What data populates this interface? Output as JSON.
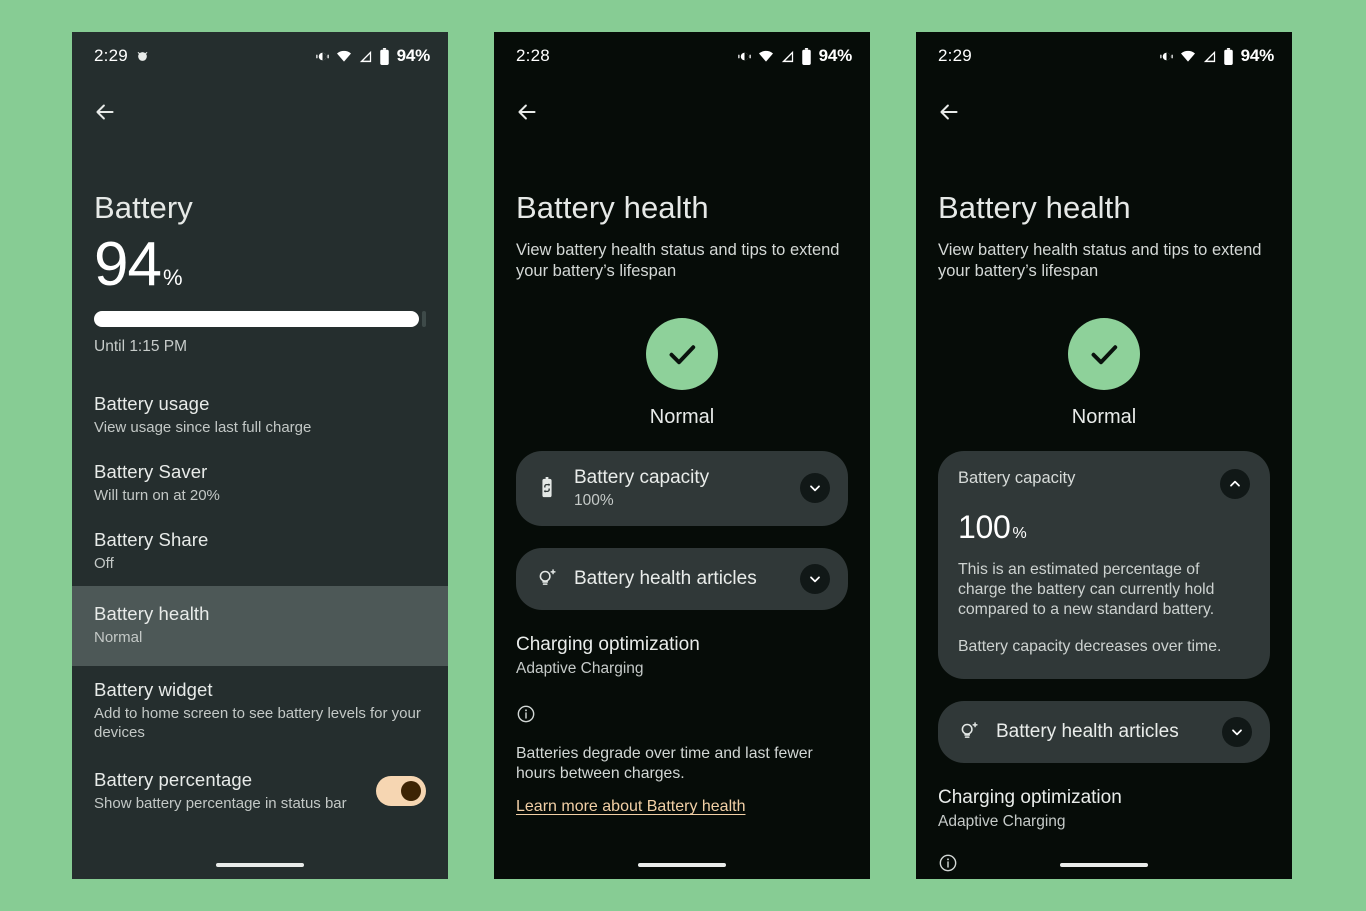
{
  "canvas": {
    "background_color": "#87cc94"
  },
  "phones": [
    {
      "id": "battery-settings",
      "background_color": "#252e2e",
      "status_bar": {
        "time": "2:29",
        "battery_percent": "94%",
        "icons": [
          "alarm-icon",
          "vibrate-icon",
          "wifi-icon",
          "signal-icon",
          "battery-icon"
        ]
      },
      "back_label": "back-arrow",
      "title": "Battery",
      "level": {
        "value": "94",
        "symbol": "%",
        "fill_percent": 94
      },
      "until_text": "Until 1:15 PM",
      "items": [
        {
          "title": "Battery usage",
          "subtitle": "View usage since last full charge",
          "highlighted": false
        },
        {
          "title": "Battery Saver",
          "subtitle": "Will turn on at 20%",
          "highlighted": false
        },
        {
          "title": "Battery Share",
          "subtitle": "Off",
          "highlighted": false
        },
        {
          "title": "Battery health",
          "subtitle": "Normal",
          "highlighted": true
        },
        {
          "title": "Battery widget",
          "subtitle": "Add to home screen to see battery levels for your devices",
          "highlighted": false
        },
        {
          "title": "Battery percentage",
          "subtitle": "Show battery percentage in status bar",
          "highlighted": false,
          "toggle": "on"
        }
      ],
      "highlight_color": "#4d5857",
      "toggle_color": "#f6d6b2"
    },
    {
      "id": "battery-health-collapsed",
      "background_color": "#060c08",
      "status_bar": {
        "time": "2:28",
        "battery_percent": "94%",
        "icons": [
          "vibrate-icon",
          "wifi-icon",
          "signal-icon",
          "battery-icon"
        ]
      },
      "title": "Battery health",
      "subtitle": "View battery health status and tips to extend your battery’s lifespan",
      "status": {
        "label": "Normal",
        "icon": "check-icon",
        "color": "#8ed19a"
      },
      "cards": [
        {
          "icon": "battery-refresh-icon",
          "title": "Battery capacity",
          "subtitle": "100%",
          "chevron": "chevron-down-icon"
        },
        {
          "icon": "lightbulb-sparkle-icon",
          "title": "Battery health articles",
          "subtitle": "",
          "chevron": "chevron-down-icon"
        }
      ],
      "charging": {
        "title": "Charging optimization",
        "subtitle": "Adaptive Charging"
      },
      "info": {
        "icon": "info-icon",
        "text": "Batteries degrade over time and last fewer hours between charges.",
        "link": "Learn more about Battery health",
        "link_color": "#f2d0a6"
      }
    },
    {
      "id": "battery-health-expanded",
      "background_color": "#060c08",
      "status_bar": {
        "time": "2:29",
        "battery_percent": "94%",
        "icons": [
          "vibrate-icon",
          "wifi-icon",
          "signal-icon",
          "battery-icon"
        ]
      },
      "title": "Battery health",
      "subtitle": "View battery health status and tips to extend your battery’s lifespan",
      "status": {
        "label": "Normal",
        "icon": "check-icon",
        "color": "#8ed19a"
      },
      "capacity_card": {
        "label": "Battery capacity",
        "value": "100",
        "symbol": "%",
        "chevron": "chevron-up-icon",
        "paragraph1": "This is an estimated percentage of charge the battery can currently hold compared to a new standard battery.",
        "paragraph2": "Battery capacity decreases over time."
      },
      "articles_card": {
        "icon": "lightbulb-sparkle-icon",
        "title": "Battery health articles",
        "chevron": "chevron-down-icon"
      },
      "charging": {
        "title": "Charging optimization",
        "subtitle": "Adaptive Charging"
      }
    }
  ]
}
